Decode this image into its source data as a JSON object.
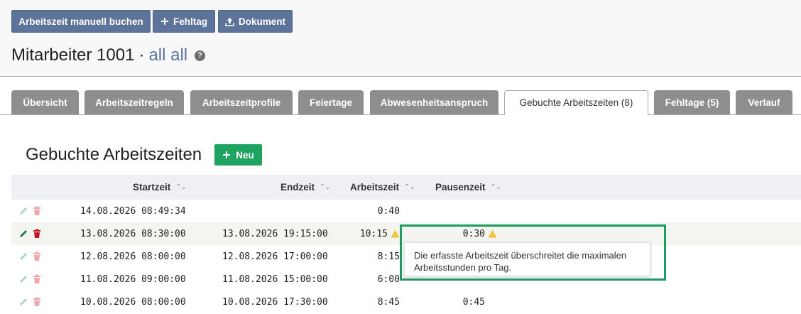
{
  "toolbar": {
    "book_manual_label": "Arbeitszeit manuell buchen",
    "absence_day_label": "Fehltag",
    "document_label": "Dokument"
  },
  "header": {
    "employee": "Mitarbeiter 1001",
    "separator": "·",
    "group_link": "all all",
    "help_glyph": "?"
  },
  "tabs": [
    {
      "label": "Übersicht"
    },
    {
      "label": "Arbeitszeitregeln"
    },
    {
      "label": "Arbeitszeitprofile"
    },
    {
      "label": "Feiertage"
    },
    {
      "label": "Abwesenheitsanspruch"
    },
    {
      "label": "Gebuchte Arbeitszeiten (8)",
      "active": true
    },
    {
      "label": "Fehltage (5)"
    },
    {
      "label": "Verlauf"
    }
  ],
  "section": {
    "title": "Gebuchte Arbeitszeiten",
    "new_label": "Neu"
  },
  "table": {
    "columns": [
      "Startzeit",
      "Endzeit",
      "Arbeitszeit",
      "Pausenzeit"
    ],
    "rows": [
      {
        "start": "14.08.2026 08:49:34",
        "end": "",
        "work": "0:40",
        "pause": ""
      },
      {
        "start": "13.08.2026 08:30:00",
        "end": "13.08.2026 19:15:00",
        "work": "10:15",
        "pause": "0:30",
        "warn": true
      },
      {
        "start": "12.08.2026 08:00:00",
        "end": "12.08.2026 17:00:00",
        "work": "8:15",
        "pause": ""
      },
      {
        "start": "11.08.2026 09:00:00",
        "end": "11.08.2026 15:00:00",
        "work": "6:00",
        "pause": ""
      },
      {
        "start": "10.08.2026 08:00:00",
        "end": "10.08.2026 17:30:00",
        "work": "8:45",
        "pause": "0:45"
      }
    ]
  },
  "tooltip": {
    "text": "Die erfasste Arbeitszeit überschreitet die maximalen Arbeitsstunden pro Tag."
  },
  "icons": {
    "plus": "plus-icon",
    "upload": "upload-icon",
    "help": "help-icon",
    "sort": "sort-icon",
    "edit": "pencil-icon",
    "delete": "trash-icon",
    "warning": "warning-icon"
  },
  "colors": {
    "primary_button": "#5e7399",
    "success_button": "#1fa361",
    "tab_inactive": "#8e8e8e",
    "link": "#5a73a5",
    "warning": "#f5c342",
    "delete_active": "#c0141c",
    "delete_muted": "#f1a6aa",
    "edit_active": "#1e7a46",
    "edit_muted": "#a7d8bc",
    "highlight_frame": "#1e9b61"
  }
}
